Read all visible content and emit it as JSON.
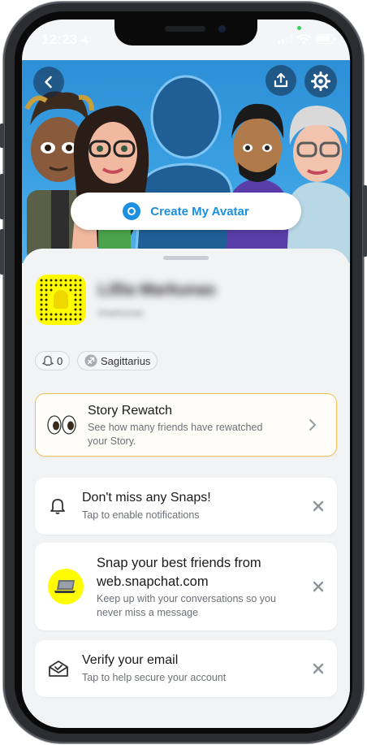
{
  "status": {
    "time": "12:23"
  },
  "hero": {
    "create_avatar_label": "Create My Avatar"
  },
  "profile": {
    "display_name": "Lillia Markunas",
    "username": "lmarkunas"
  },
  "chips": {
    "friends_count": "0",
    "zodiac": "Sagittarius"
  },
  "cards": [
    {
      "title": "Story Rewatch",
      "subtitle_line1": "See how many friends have rewatched",
      "subtitle_line2": "your Story.",
      "icon": "eyes-icon",
      "action": "chevron-right-icon"
    },
    {
      "title": "Don't miss any Snaps!",
      "subtitle_line1": "Tap to enable notifications",
      "icon": "bell-icon",
      "action": "close-icon"
    },
    {
      "title_line1": "Snap your best friends from",
      "title_line2": "web.snapchat.com",
      "subtitle_line1": "Keep up with your conversations so you",
      "subtitle_line2": "never miss a message",
      "icon": "laptop-icon",
      "action": "close-icon"
    },
    {
      "title": "Verify your email",
      "subtitle_line1": "Tap to help secure your account",
      "icon": "envelope-check-icon",
      "action": "close-icon"
    }
  ],
  "colors": {
    "hero_blue": "#3aa0e2",
    "snap_yellow": "#fffc00",
    "accent_blue": "#1b8fe0",
    "rewatch_border": "#f0c15a"
  }
}
